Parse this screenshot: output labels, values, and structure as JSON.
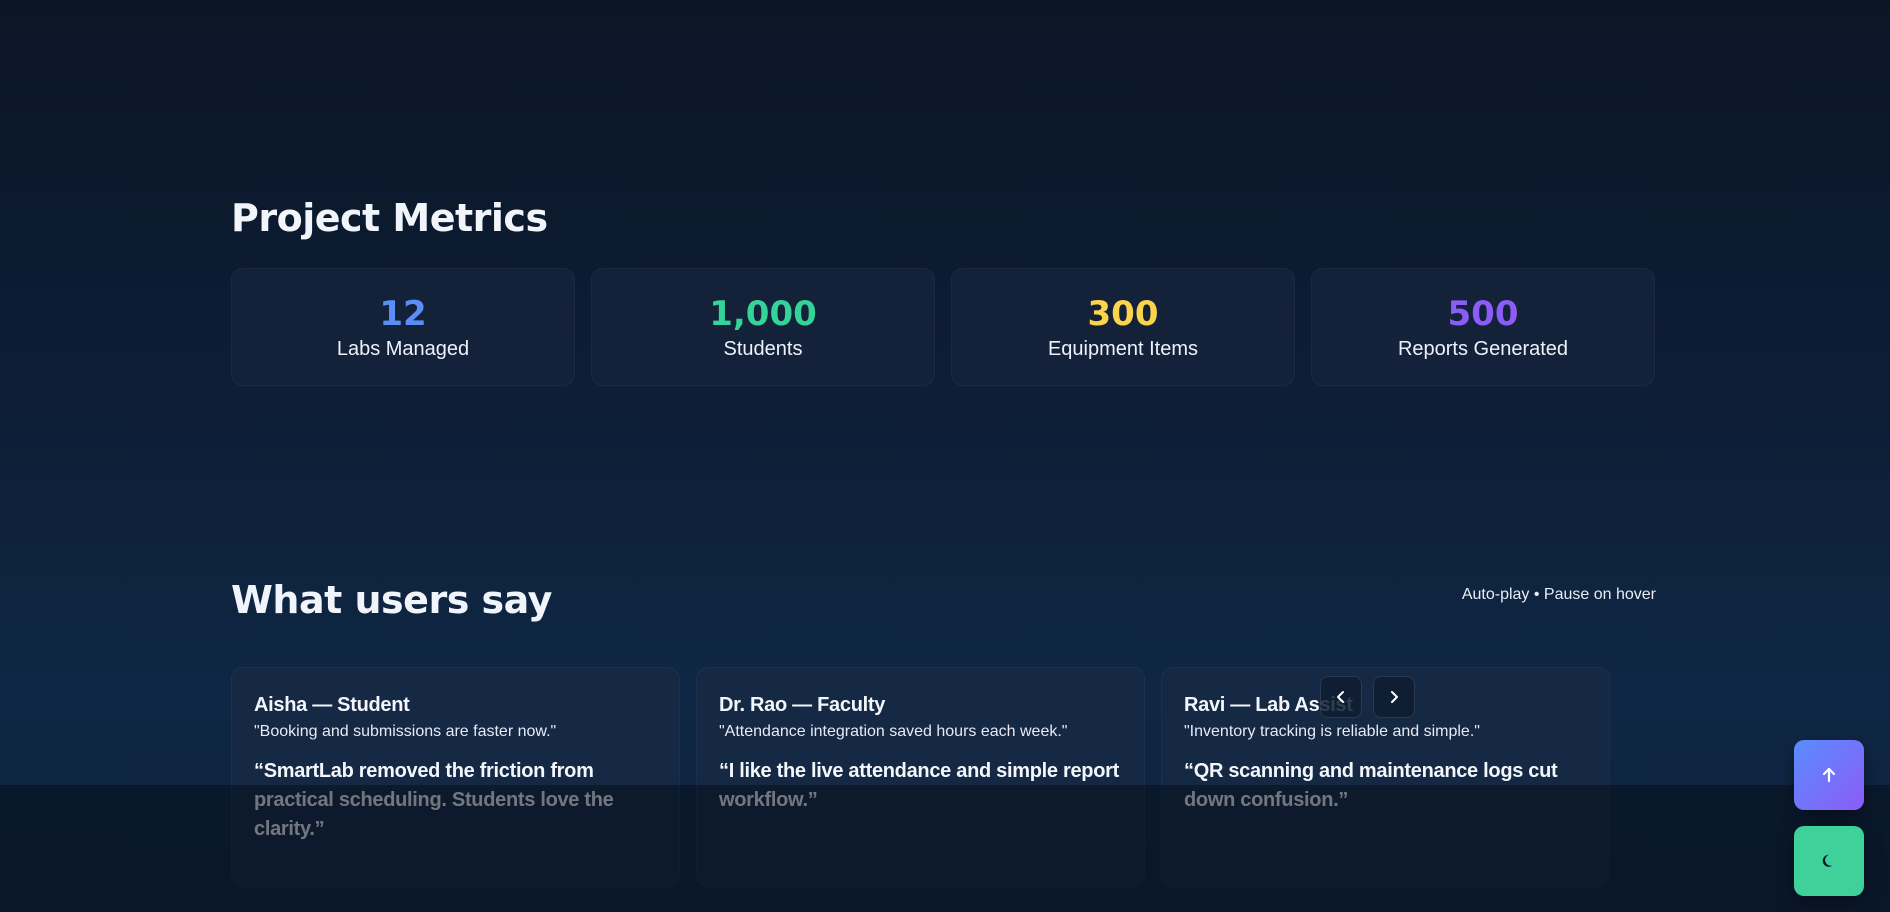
{
  "metrics": {
    "title": "Project Metrics",
    "items": [
      {
        "value": "12",
        "label": "Labs Managed",
        "color": "#5b8df6"
      },
      {
        "value": "1,000",
        "label": "Students",
        "color": "#34d399"
      },
      {
        "value": "300",
        "label": "Equipment Items",
        "color": "#fcd34d"
      },
      {
        "value": "500",
        "label": "Reports Generated",
        "color": "#8b5cf6"
      }
    ]
  },
  "testimonials": {
    "title": "What users say",
    "autoplay_note": "Auto-play • Pause on hover",
    "items": [
      {
        "name": "Aisha — Student",
        "short": "\"Booking and submissions are faster now.\"",
        "quote": "“SmartLab removed the friction from practical scheduling. Students love the clarity.”"
      },
      {
        "name": "Dr. Rao — Faculty",
        "short": "\"Attendance integration saved hours each week.\"",
        "quote": "“I like the live attendance and simple report workflow.”"
      },
      {
        "name": "Ravi — Lab Assist",
        "short": "\"Inventory tracking is reliable and simple.\"",
        "quote": "“QR scanning and maintenance logs cut down confusion.”"
      }
    ],
    "prev_icon": "chevron-left-icon",
    "next_icon": "chevron-right-icon"
  },
  "floating_buttons": {
    "scroll_top_icon": "arrow-up-icon",
    "theme_icon": "moon-icon",
    "scroll_top_colors": [
      "#5a8cff",
      "#8b5cf6"
    ],
    "theme_color": "#3ed19a"
  }
}
